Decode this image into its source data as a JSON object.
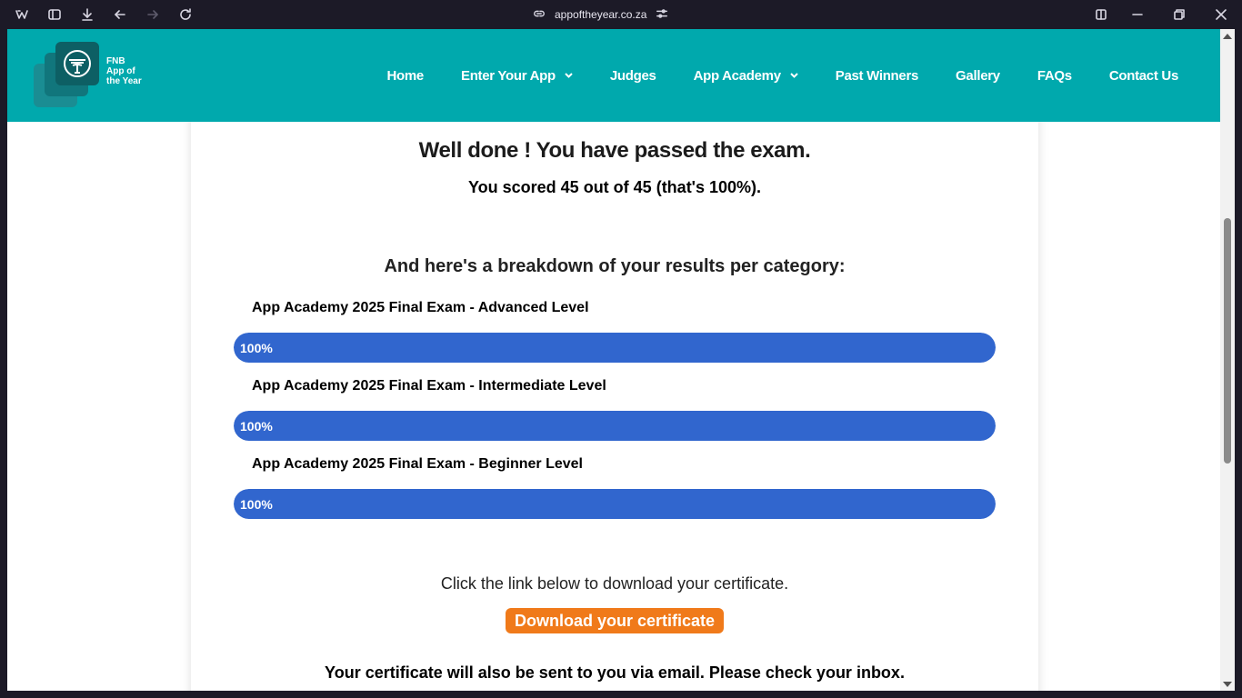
{
  "browser": {
    "url": "appoftheyear.co.za"
  },
  "site": {
    "logo_text": "FNB\nApp of\nthe Year",
    "nav": [
      {
        "label": "Home",
        "has_dropdown": false
      },
      {
        "label": "Enter Your App",
        "has_dropdown": true
      },
      {
        "label": "Judges",
        "has_dropdown": false
      },
      {
        "label": "App Academy",
        "has_dropdown": true
      },
      {
        "label": "Past Winners",
        "has_dropdown": false
      },
      {
        "label": "Gallery",
        "has_dropdown": false
      },
      {
        "label": "FAQs",
        "has_dropdown": false
      },
      {
        "label": "Contact Us",
        "has_dropdown": false
      }
    ]
  },
  "results": {
    "title": "Well done ! You have passed the exam.",
    "score_text": "You scored 45 out of 45 (that's 100%).",
    "breakdown_heading": "And here's a breakdown of your results per category:",
    "categories": [
      {
        "name": "App Academy 2025 Final Exam - Advanced Level",
        "percent": 100,
        "label": "100%"
      },
      {
        "name": "App Academy 2025 Final Exam - Intermediate Level",
        "percent": 100,
        "label": "100%"
      },
      {
        "name": "App Academy 2025 Final Exam - Beginner Level",
        "percent": 100,
        "label": "100%"
      }
    ],
    "download_intro": "Click the link below to download your certificate.",
    "download_button": "Download your certificate",
    "email_note": "Your certificate will also be sent to you via email. Please check your inbox."
  },
  "colors": {
    "header": "#00a9ad",
    "progress": "#3166ce",
    "button": "#f07a1a"
  }
}
